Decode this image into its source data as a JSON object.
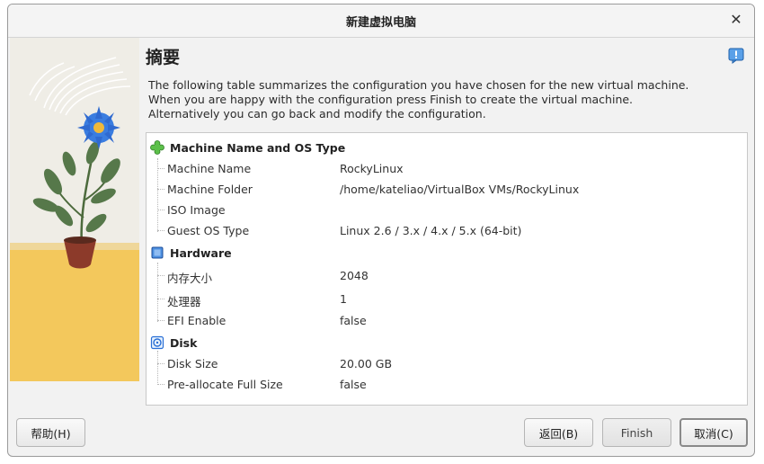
{
  "window": {
    "title": "新建虚拟电脑"
  },
  "page": {
    "heading": "摘要",
    "description": [
      "The following table summarizes the configuration you have chosen for the new virtual machine.",
      "When you are happy with the configuration press Finish to create the virtual machine.",
      "Alternatively you can go back and modify the configuration."
    ]
  },
  "summary": {
    "groups": [
      {
        "title": "Machine Name and OS Type",
        "icon": "puzzle-icon",
        "items": [
          {
            "key": "Machine Name",
            "value": "RockyLinux"
          },
          {
            "key": "Machine Folder",
            "value": "/home/kateliao/VirtualBox VMs/RockyLinux"
          },
          {
            "key": "ISO Image",
            "value": ""
          },
          {
            "key": "Guest OS Type",
            "value": "Linux 2.6 / 3.x / 4.x / 5.x (64-bit)"
          }
        ]
      },
      {
        "title": "Hardware",
        "icon": "chip-icon",
        "items": [
          {
            "key": "内存大小",
            "value": "2048"
          },
          {
            "key": "处理器",
            "value": "1"
          },
          {
            "key": "EFI Enable",
            "value": "false"
          }
        ]
      },
      {
        "title": "Disk",
        "icon": "disk-icon",
        "items": [
          {
            "key": "Disk Size",
            "value": "20.00 GB"
          },
          {
            "key": "Pre-allocate Full Size",
            "value": "false"
          }
        ]
      }
    ]
  },
  "buttons": {
    "help": "帮助(H)",
    "back": "返回(B)",
    "finish": "Finish",
    "cancel": "取消(C)"
  },
  "colors": {
    "accent_blue": "#2a6fd6",
    "flower_blue": "#3a7de0",
    "pot_red": "#8c3a2a",
    "sand": "#f3c85c"
  }
}
